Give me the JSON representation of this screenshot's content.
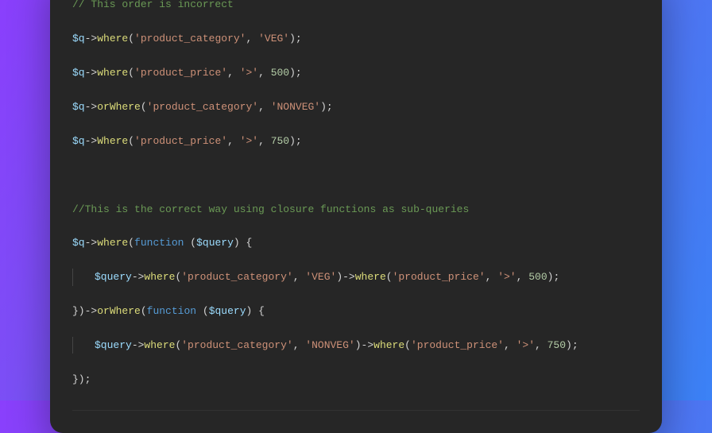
{
  "code": {
    "comment1": "// This order is incorrect",
    "l2": {
      "v": "$q",
      "m": "where",
      "a1": "'product_category'",
      "a2": "'VEG'"
    },
    "l3": {
      "v": "$q",
      "m": "where",
      "a1": "'product_price'",
      "a2": "'>'",
      "a3": "500"
    },
    "l4": {
      "v": "$q",
      "m": "orWhere",
      "a1": "'product_category'",
      "a2": "'NONVEG'"
    },
    "l5": {
      "v": "$q",
      "m": "Where",
      "a1": "'product_price'",
      "a2": "'>'",
      "a3": "750"
    },
    "comment2": "//This is the correct way using closure functions as sub-queries",
    "l7": {
      "v": "$q",
      "m": "where",
      "kw": "function",
      "p": "$query"
    },
    "l8": {
      "v": "$query",
      "m1": "where",
      "a1": "'product_category'",
      "a2": "'VEG'",
      "m2": "where",
      "a3": "'product_price'",
      "a4": "'>'",
      "a5": "500"
    },
    "l9": {
      "m": "orWhere",
      "kw": "function",
      "p": "$query"
    },
    "l10": {
      "v": "$query",
      "m1": "where",
      "a1": "'product_category'",
      "a2": "'NONVEG'",
      "m2": "where",
      "a3": "'product_price'",
      "a4": "'>'",
      "a5": "750"
    },
    "arrow": "->",
    "brace_open": "{",
    "brace_close": "}",
    "close_chain": "})",
    "terminator": ";",
    "comma": ", ",
    "open": "(",
    "close": ")",
    "closure_close": "});"
  }
}
